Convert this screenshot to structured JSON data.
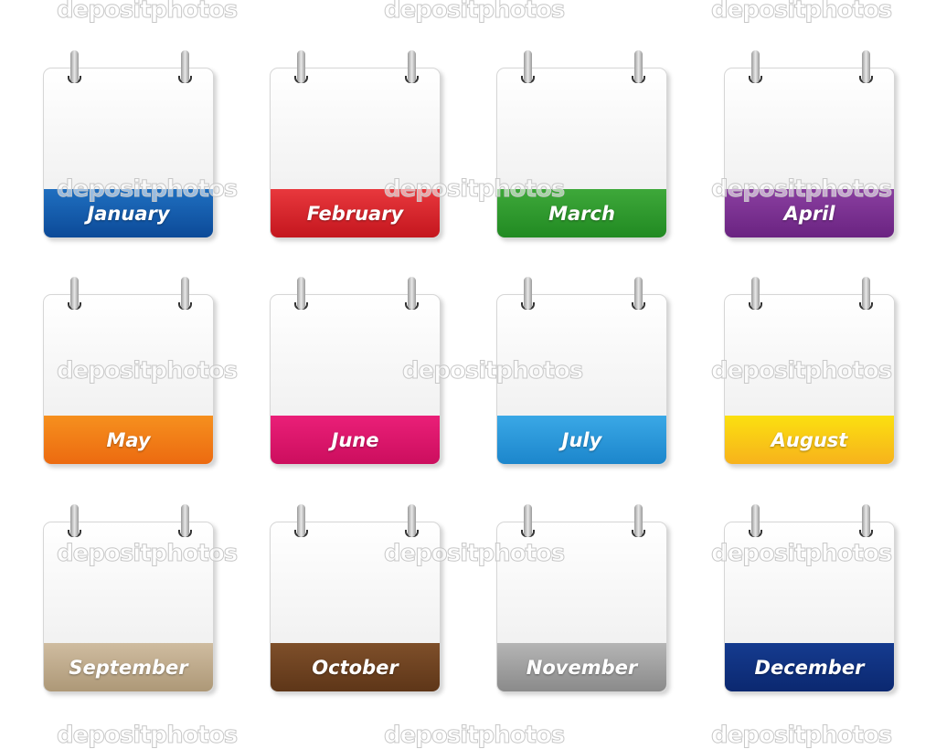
{
  "months": [
    {
      "label": "January",
      "colors": [
        "#1f6fc0",
        "#0c4a98"
      ]
    },
    {
      "label": "February",
      "colors": [
        "#e8383d",
        "#c4161e"
      ]
    },
    {
      "label": "March",
      "colors": [
        "#3ea83a",
        "#218a22"
      ]
    },
    {
      "label": "April",
      "colors": [
        "#8a3fa0",
        "#6a2381"
      ]
    },
    {
      "label": "May",
      "colors": [
        "#f6901e",
        "#ec6a10"
      ]
    },
    {
      "label": "June",
      "colors": [
        "#ea1f78",
        "#cc0e5e"
      ]
    },
    {
      "label": "July",
      "colors": [
        "#3aa8e6",
        "#1c86cc"
      ]
    },
    {
      "label": "August",
      "colors": [
        "#fbe010",
        "#f7b21c"
      ]
    },
    {
      "label": "September",
      "colors": [
        "#cfbca0",
        "#ad9877"
      ]
    },
    {
      "label": "October",
      "colors": [
        "#7e4f2a",
        "#5e3618"
      ]
    },
    {
      "label": "November",
      "colors": [
        "#b5b5b5",
        "#8a8a8a"
      ]
    },
    {
      "label": "December",
      "colors": [
        "#153b8f",
        "#0b2870"
      ]
    }
  ],
  "watermark": "depositphotos"
}
